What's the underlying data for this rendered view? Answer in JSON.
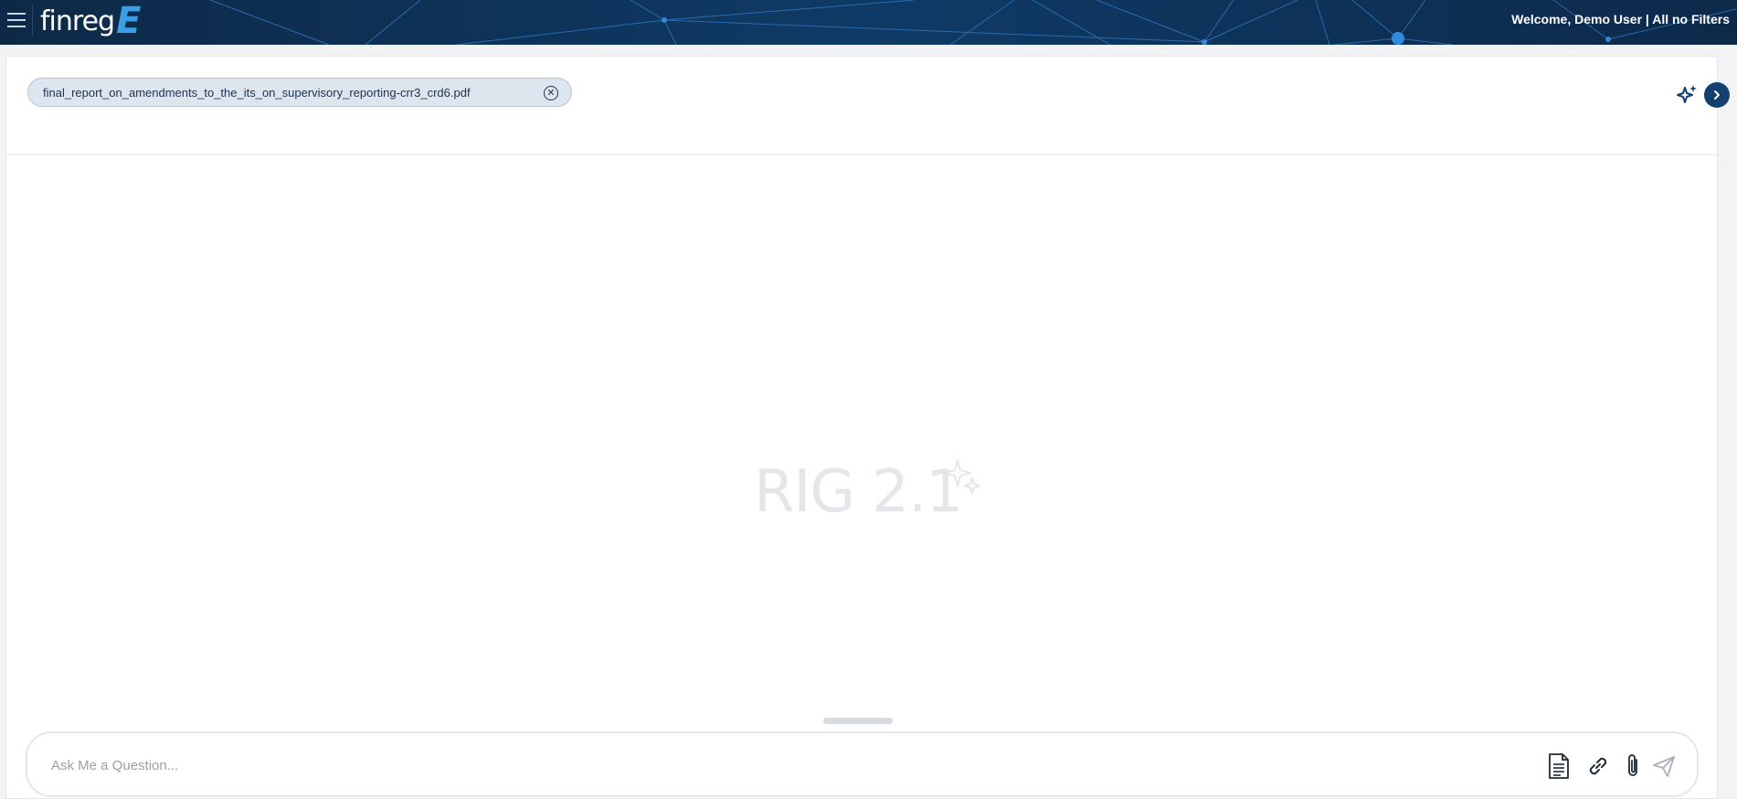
{
  "header": {
    "logo_text": "finreg",
    "logo_mark": "E",
    "welcome_text": "Welcome, Demo User  |   All no Filters",
    "menu_icon": "hamburger-icon"
  },
  "document_chip": {
    "filename": "final_report_on_amendments_to_the_its_on_supervisory_reporting-crr3_crd6.pdf",
    "close_icon": "close-circle-icon"
  },
  "side_controls": {
    "sparkle_icon": "sparkle-icon",
    "expand_icon": "chevron-right-icon"
  },
  "watermark": {
    "text": "RIG 2.1",
    "icon": "sparkle-icon"
  },
  "composer": {
    "placeholder": "Ask Me a Question...",
    "tools": [
      "document-icon",
      "link-icon",
      "paperclip-icon",
      "send-icon"
    ]
  },
  "colors": {
    "header_bg": "#0f3a66",
    "accent": "#13406e",
    "logo_accent": "#3aa0e6",
    "chip_bg": "#dde5ee"
  }
}
